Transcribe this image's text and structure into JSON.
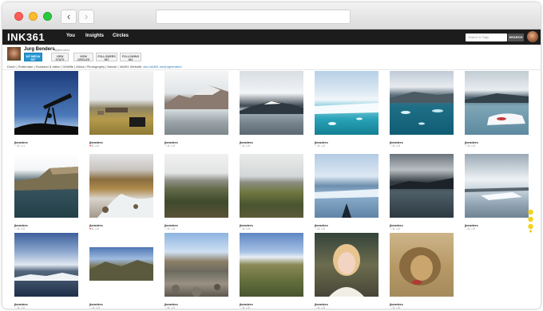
{
  "browser": {
    "back_glyph": "‹",
    "forward_glyph": "›",
    "url": ""
  },
  "app": {
    "logo": "INK361",
    "nav": [
      "You",
      "Insights",
      "Circles"
    ],
    "search_placeholder": "Search & Tags",
    "search_button": "SEARCH"
  },
  "profile": {
    "name": "Jurg Benders",
    "handle": "@jbenders",
    "buttons": [
      {
        "line1": "MY MEDIA",
        "line2": "537",
        "active": true
      },
      {
        "line1": "VIEW",
        "line2": "STATS",
        "active": false
      },
      {
        "line1": "VIEW",
        "line2": "CIRCLES",
        "active": false
      },
      {
        "line1": "FOLLOWERS",
        "line2": "567",
        "active": false
      },
      {
        "line1": "FOLLOWING",
        "line2": "361",
        "active": false
      }
    ],
    "bio": "Dutch | Rotterdam | Husband & father | Wildlife | Africa | Photography | Nature | Ink361 Website: ",
    "bio_link": "ako.ink361.me/jurgbenders"
  },
  "grid": {
    "items": [
      {
        "user": "jbenders",
        "scene": "night-telescope",
        "likes": "11",
        "comments": "1",
        "liked": false
      },
      {
        "user": "jbenders",
        "scene": "village",
        "likes": "11",
        "comments": "0",
        "liked": true
      },
      {
        "user": "jbenders",
        "scene": "mountain-lake",
        "likes": "11",
        "comments": "0",
        "liked": false
      },
      {
        "user": "jbenders",
        "scene": "snow-mountain",
        "likes": "11",
        "comments": "0",
        "liked": false
      },
      {
        "user": "jbenders",
        "scene": "glacier",
        "likes": "11",
        "comments": "0",
        "liked": false
      },
      {
        "user": "jbenders",
        "scene": "icebergs",
        "likes": "11",
        "comments": "0",
        "liked": false
      },
      {
        "user": "jbenders",
        "scene": "ice-floe",
        "likes": "11",
        "comments": "0",
        "liked": false
      },
      {
        "user": "jbenders",
        "scene": "cliffs",
        "likes": "11",
        "comments": "0",
        "liked": false
      },
      {
        "user": "jbenders",
        "scene": "stream",
        "likes": "11",
        "comments": "0",
        "liked": true
      },
      {
        "user": "jbenders",
        "scene": "mossy-field",
        "likes": "11",
        "comments": "0",
        "liked": false
      },
      {
        "user": "jbenders",
        "scene": "mossy-field-2",
        "likes": "11",
        "comments": "0",
        "liked": false
      },
      {
        "user": "jbenders",
        "scene": "boat-glacier",
        "likes": "11",
        "comments": "0",
        "liked": false
      },
      {
        "user": "jbenders",
        "scene": "dark-fjord",
        "likes": "11",
        "comments": "0",
        "liked": false
      },
      {
        "user": "jbenders",
        "scene": "bright-ice",
        "likes": "11",
        "comments": "0",
        "liked": false
      },
      {
        "user": "jbenders",
        "scene": "cloud-sea",
        "likes": "11",
        "comments": "0",
        "liked": false
      },
      {
        "user": "jbenders",
        "scene": "valley",
        "likes": "11",
        "comments": "0",
        "liked": false
      },
      {
        "user": "jbenders",
        "scene": "rocky-valley",
        "likes": "11",
        "comments": "0",
        "liked": false
      },
      {
        "user": "jbenders",
        "scene": "green-hills",
        "likes": "11",
        "comments": "0",
        "liked": false
      },
      {
        "user": "jbenders",
        "scene": "girl-portrait",
        "likes": "11",
        "comments": "0",
        "liked": false
      },
      {
        "user": "jbenders",
        "scene": "lion",
        "likes": "11",
        "comments": "0",
        "liked": false
      }
    ]
  },
  "colors": {
    "appbar": "#1c1c1c",
    "accent": "#2a97d3",
    "heart": "#dd2222",
    "scroll_hint": "#f2d21a"
  }
}
